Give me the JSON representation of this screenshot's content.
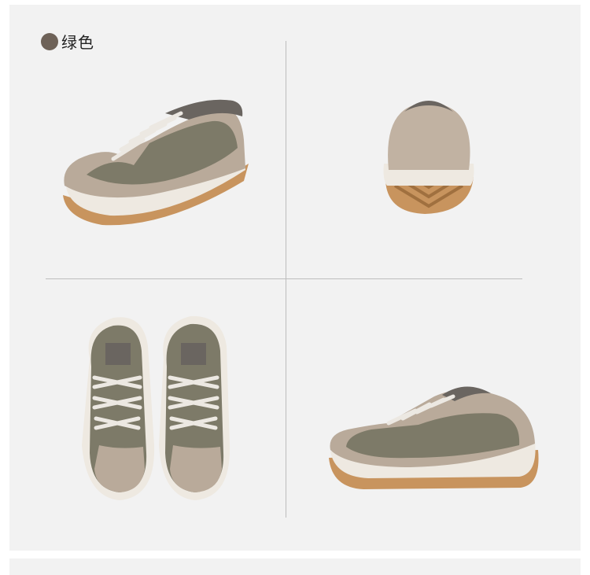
{
  "color_option": {
    "label": "绿色",
    "swatch_color": "#6e6258"
  },
  "colors": {
    "suede": "#7d7a68",
    "leather": "#b9aa9a",
    "collar": "#6a6560",
    "sole_white": "#eee9e1",
    "outsole": "#c8945e",
    "lace": "#ece8e2"
  },
  "photos": [
    {
      "view": "three-quarter-front"
    },
    {
      "view": "rear"
    },
    {
      "view": "top-pair"
    },
    {
      "view": "side"
    }
  ]
}
